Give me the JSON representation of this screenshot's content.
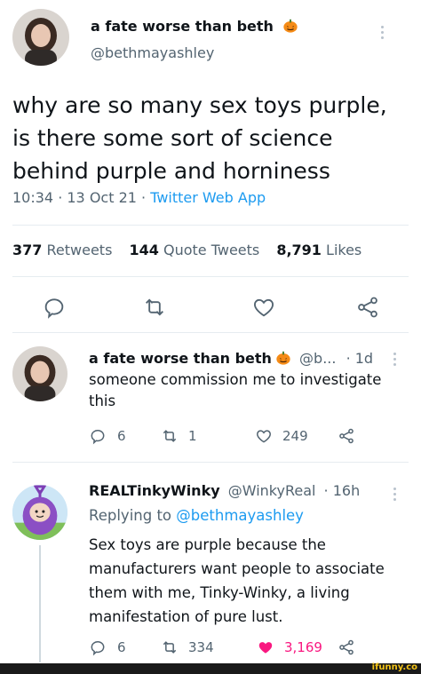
{
  "main_tweet": {
    "display_name": "a fate worse than beth",
    "handle": "@bethmayashley",
    "text_lines": [
      "why are so many sex toys purple,",
      "is there some sort of science",
      "behind purple and horniness"
    ],
    "timestamp": "10:34 · 13 Oct 21 · ",
    "client": "Twitter Web App",
    "stats": {
      "retweets_count": "377",
      "retweets_label": "Retweets",
      "quotes_count": "144",
      "quotes_label": "Quote Tweets",
      "likes_count": "8,791",
      "likes_label": "Likes"
    }
  },
  "reply1": {
    "display_name": "a fate worse than beth",
    "handle": "@b...",
    "age": "· 1d",
    "text_lines": [
      "someone commission me to investigate",
      "this"
    ],
    "replies": "6",
    "retweets": "1",
    "likes": "249"
  },
  "reply2": {
    "display_name": "REALTinkyWinky",
    "handle": "@WinkyReal",
    "age": "· 16h",
    "replying_prefix": "Replying to ",
    "replying_to": "@bethmayashley",
    "text_lines": [
      "Sex toys are purple because the",
      "manufacturers want people to associate",
      "them with me, Tinky-Winky, a living",
      "manifestation of pure lust."
    ],
    "replies": "6",
    "retweets": "334",
    "likes": "3,169"
  },
  "watermark": "ifunny.co",
  "colors": {
    "link": "#1d9bf0",
    "secondary": "#536471",
    "like_pink": "#f91880",
    "footer": "#1a1a1a",
    "watermark": "#f5c518"
  },
  "icons": [
    "reply-icon",
    "retweet-icon",
    "like-icon",
    "share-icon",
    "more-icon",
    "pumpkin-emoji"
  ]
}
